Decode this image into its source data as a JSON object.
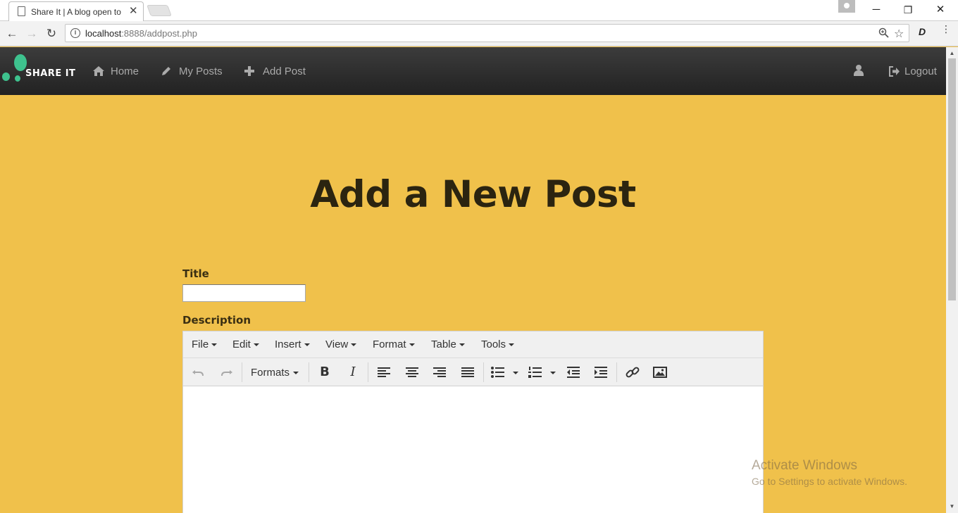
{
  "browser": {
    "tab_title": "Share It | A blog open to",
    "tab_close": "✕",
    "url_host": "localhost",
    "url_path": ":8888/addpost.php",
    "controls": {
      "minimize": "─",
      "restore": "❐",
      "close": "✕"
    },
    "back": "←",
    "forward": "→",
    "reload": "↻",
    "ext_label": "D"
  },
  "navbar": {
    "brand": "SHARE IT",
    "links": [
      {
        "label": "Home",
        "icon": "home-icon"
      },
      {
        "label": "My Posts",
        "icon": "pencil-icon"
      },
      {
        "label": "Add Post",
        "icon": "plus-icon"
      }
    ],
    "logout": "Logout"
  },
  "page": {
    "title": "Add a New Post",
    "title_label": "Title",
    "title_value": "",
    "description_label": "Description"
  },
  "editor": {
    "menus": [
      "File",
      "Edit",
      "Insert",
      "View",
      "Format",
      "Table",
      "Tools"
    ],
    "formats_label": "Formats"
  },
  "watermark": {
    "line1": "Activate Windows",
    "line2": "Go to Settings to activate Windows."
  },
  "colors": {
    "page_bg": "#f0c14b",
    "navbar_bg": "#2c2c2c",
    "logo_green": "#3ec28e"
  }
}
